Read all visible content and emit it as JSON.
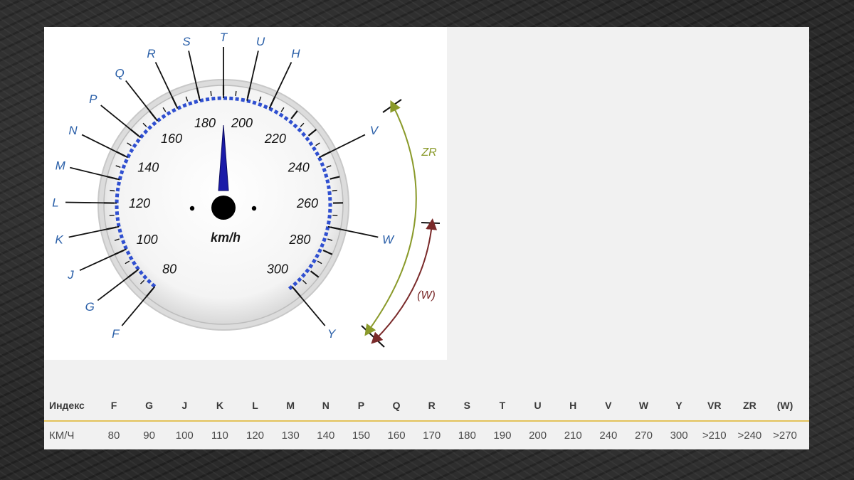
{
  "gauge": {
    "unit_label": "km/h",
    "scale_numbers": [
      "80",
      "100",
      "120",
      "140",
      "160",
      "180",
      "200",
      "220",
      "240",
      "260",
      "280",
      "300"
    ],
    "letters": [
      "F",
      "G",
      "J",
      "K",
      "L",
      "M",
      "N",
      "P",
      "Q",
      "R",
      "S",
      "T",
      "U",
      "H",
      "V",
      "W",
      "Y"
    ],
    "bracket_zr": "ZR",
    "bracket_w": "(W)"
  },
  "table": {
    "header_label": "Индекс",
    "value_label": "КМ/Ч",
    "columns": [
      {
        "index": "F",
        "kmh": "80"
      },
      {
        "index": "G",
        "kmh": "90"
      },
      {
        "index": "J",
        "kmh": "100"
      },
      {
        "index": "K",
        "kmh": "110"
      },
      {
        "index": "L",
        "kmh": "120"
      },
      {
        "index": "M",
        "kmh": "130"
      },
      {
        "index": "N",
        "kmh": "140"
      },
      {
        "index": "P",
        "kmh": "150"
      },
      {
        "index": "Q",
        "kmh": "160"
      },
      {
        "index": "R",
        "kmh": "170"
      },
      {
        "index": "S",
        "kmh": "180"
      },
      {
        "index": "T",
        "kmh": "190"
      },
      {
        "index": "U",
        "kmh": "200"
      },
      {
        "index": "H",
        "kmh": "210"
      },
      {
        "index": "V",
        "kmh": "240"
      },
      {
        "index": "W",
        "kmh": "270"
      },
      {
        "index": "Y",
        "kmh": "300"
      },
      {
        "index": "VR",
        "kmh": ">210"
      },
      {
        "index": "ZR",
        "kmh": ">240"
      },
      {
        "index": "(W)",
        "kmh": ">270"
      }
    ]
  },
  "colors": {
    "letter": "#2a5fa8",
    "dash_blue": "#2f4fd0",
    "needle": "#1a1aa8",
    "zr_arc": "#8a9a2a",
    "w_arc": "#7a2a2a",
    "divider": "#e2c25a"
  }
}
